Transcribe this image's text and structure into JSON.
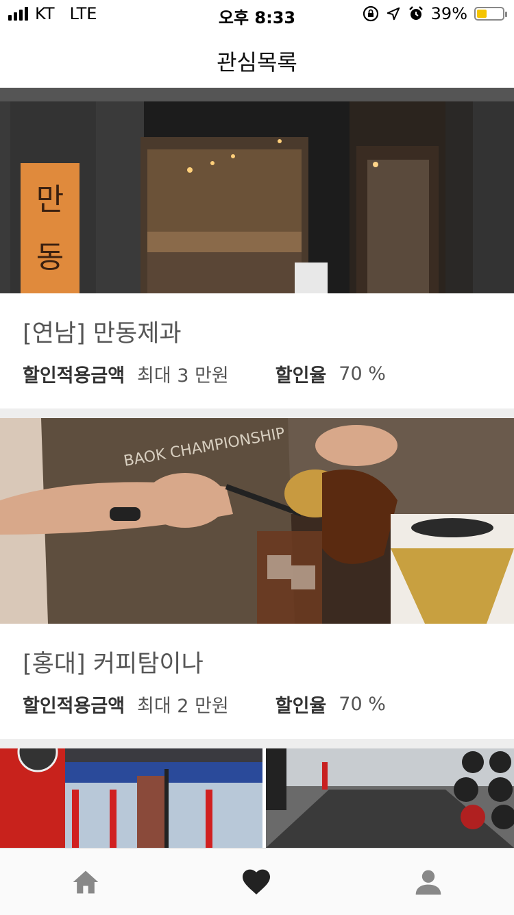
{
  "status_bar": {
    "carrier": "KT",
    "network": "LTE",
    "time": "오후 8:33",
    "battery_percent": "39%",
    "battery_level": 0.39,
    "icons": [
      "orientation-lock-icon",
      "location-arrow-icon",
      "alarm-icon"
    ]
  },
  "header": {
    "title": "관심목록"
  },
  "favorites": [
    {
      "title": "[연남] 만동제과",
      "amount_label": "할인적용금액",
      "amount_value": "최대 3 만원",
      "rate_label": "할인율",
      "rate_value": "70 %",
      "image": "bakery-storefront"
    },
    {
      "title": "[홍대] 커피탐이나",
      "amount_label": "할인적용금액",
      "amount_value": "최대 2 만원",
      "rate_label": "할인율",
      "rate_value": "70 %",
      "image": "barista-pouring-coffee"
    },
    {
      "image": "gym-interior"
    }
  ],
  "tab_bar": {
    "tabs": [
      "home-icon",
      "heart-icon",
      "profile-icon"
    ],
    "active": "heart-icon",
    "colors": {
      "inactive": "#888888",
      "active": "#222222"
    }
  }
}
